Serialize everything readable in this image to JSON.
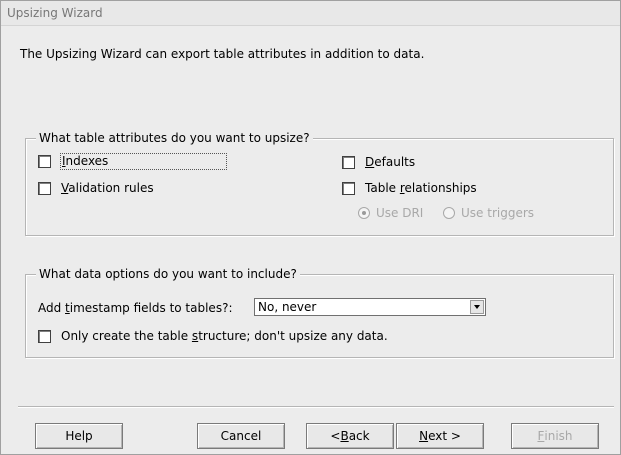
{
  "window": {
    "title": "Upsizing Wizard"
  },
  "intro_text": "The Upsizing Wizard can export table attributes in addition to data.",
  "attributes_group": {
    "legend": "What table attributes do you want to upsize?",
    "indexes": {
      "pre": "",
      "key": "I",
      "post": "ndexes",
      "checked": false
    },
    "validation_rules": {
      "pre": "",
      "key": "V",
      "post": "alidation rules",
      "checked": false
    },
    "defaults": {
      "pre": "",
      "key": "D",
      "post": "efaults",
      "checked": false
    },
    "table_relationships": {
      "pre": "Table ",
      "key": "r",
      "post": "elationships",
      "checked": false
    },
    "use_dri": {
      "label": "Use DRI",
      "selected": true,
      "enabled": false
    },
    "use_triggers": {
      "label": "Use triggers",
      "selected": false,
      "enabled": false
    }
  },
  "data_group": {
    "legend": "What data options do you want to include?",
    "timestamp_label": {
      "pre": "Add ",
      "key": "t",
      "post": "imestamp fields to tables?:"
    },
    "timestamp_value": "No, never",
    "structure_only": {
      "pre": "Only create the table ",
      "key": "s",
      "post": "tructure; don't upsize any data.",
      "checked": false
    }
  },
  "buttons": {
    "help": "Help",
    "cancel": "Cancel",
    "back": {
      "pre": "< ",
      "key": "B",
      "post": "ack"
    },
    "next": {
      "pre": "",
      "key": "N",
      "post": "ext >"
    },
    "finish": {
      "pre": "",
      "key": "F",
      "post": "inish"
    }
  }
}
